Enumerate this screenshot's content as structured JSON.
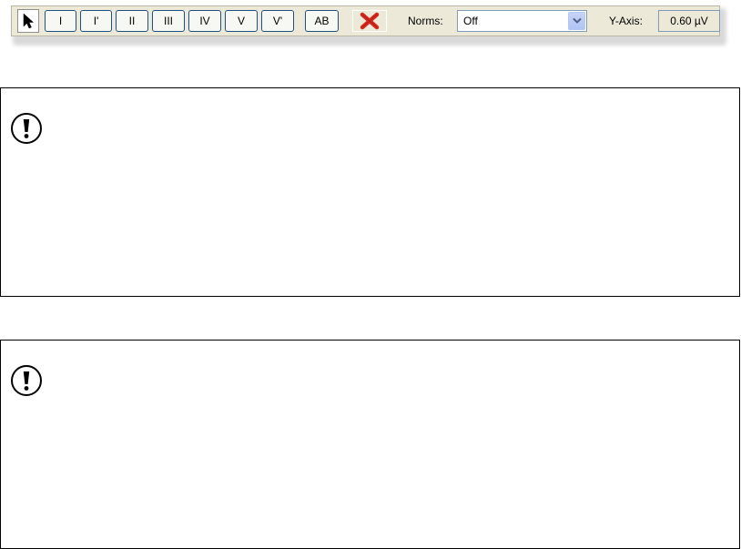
{
  "toolbar": {
    "pointer_tool": {
      "icon": "arrow-pointer-icon"
    },
    "wave_buttons": [
      {
        "label": "I"
      },
      {
        "label": "I'"
      },
      {
        "label": "II"
      },
      {
        "label": "III"
      },
      {
        "label": "IV"
      },
      {
        "label": "V"
      },
      {
        "label": "V'"
      },
      {
        "label": "AB"
      }
    ],
    "clear_button": {
      "icon": "red-x-icon",
      "color": "#d62a1e"
    },
    "norms": {
      "label": "Norms:",
      "selected": "Off"
    },
    "y_axis": {
      "label": "Y-Axis:",
      "value": "0.60 µV"
    }
  },
  "notes": [
    {
      "icon": "exclamation-circle-icon"
    },
    {
      "icon": "exclamation-circle-icon"
    }
  ],
  "colors": {
    "toolbar_bg": "#ece9d8",
    "button_border": "#1c5180",
    "select_border": "#7f9db9"
  }
}
